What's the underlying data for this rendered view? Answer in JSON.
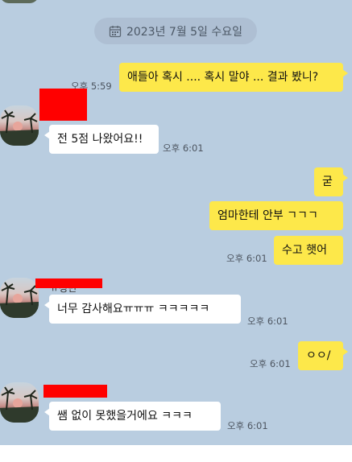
{
  "date_separator": "2023년 7월 5일 수요일",
  "messages": [
    {
      "text": "애들아 혹시 .... 혹시 말야 ... 결과 봤니?",
      "time": "오후 5:59"
    },
    {
      "text": "전 5점 나왔어요!!",
      "time": "오후 6:01"
    },
    {
      "text": "굳"
    },
    {
      "text": "엄마한테 안부 ㄱㄱㄱ"
    },
    {
      "text": "수고 햇어",
      "time": "오후 6:01"
    },
    {
      "sender": "ㅠ정빈",
      "text": "너무 감사해요ㅠㅠㅠ ㅋㅋㅋㅋㅋ",
      "time": "오후 6:01"
    },
    {
      "text": "ㅇㅇ/",
      "time": "오후 6:01"
    },
    {
      "text": "쌤 없이 못했을거에요 ㅋㅋㅋ",
      "time": "오후 6:01"
    }
  ],
  "colors": {
    "background": "#b9cde0",
    "my_bubble": "#fde84a",
    "other_bubble": "#ffffff",
    "redaction": "#ff0000"
  },
  "icons": {
    "date_separator": "calendar-icon",
    "avatar": "sunset-palm-avatar"
  }
}
